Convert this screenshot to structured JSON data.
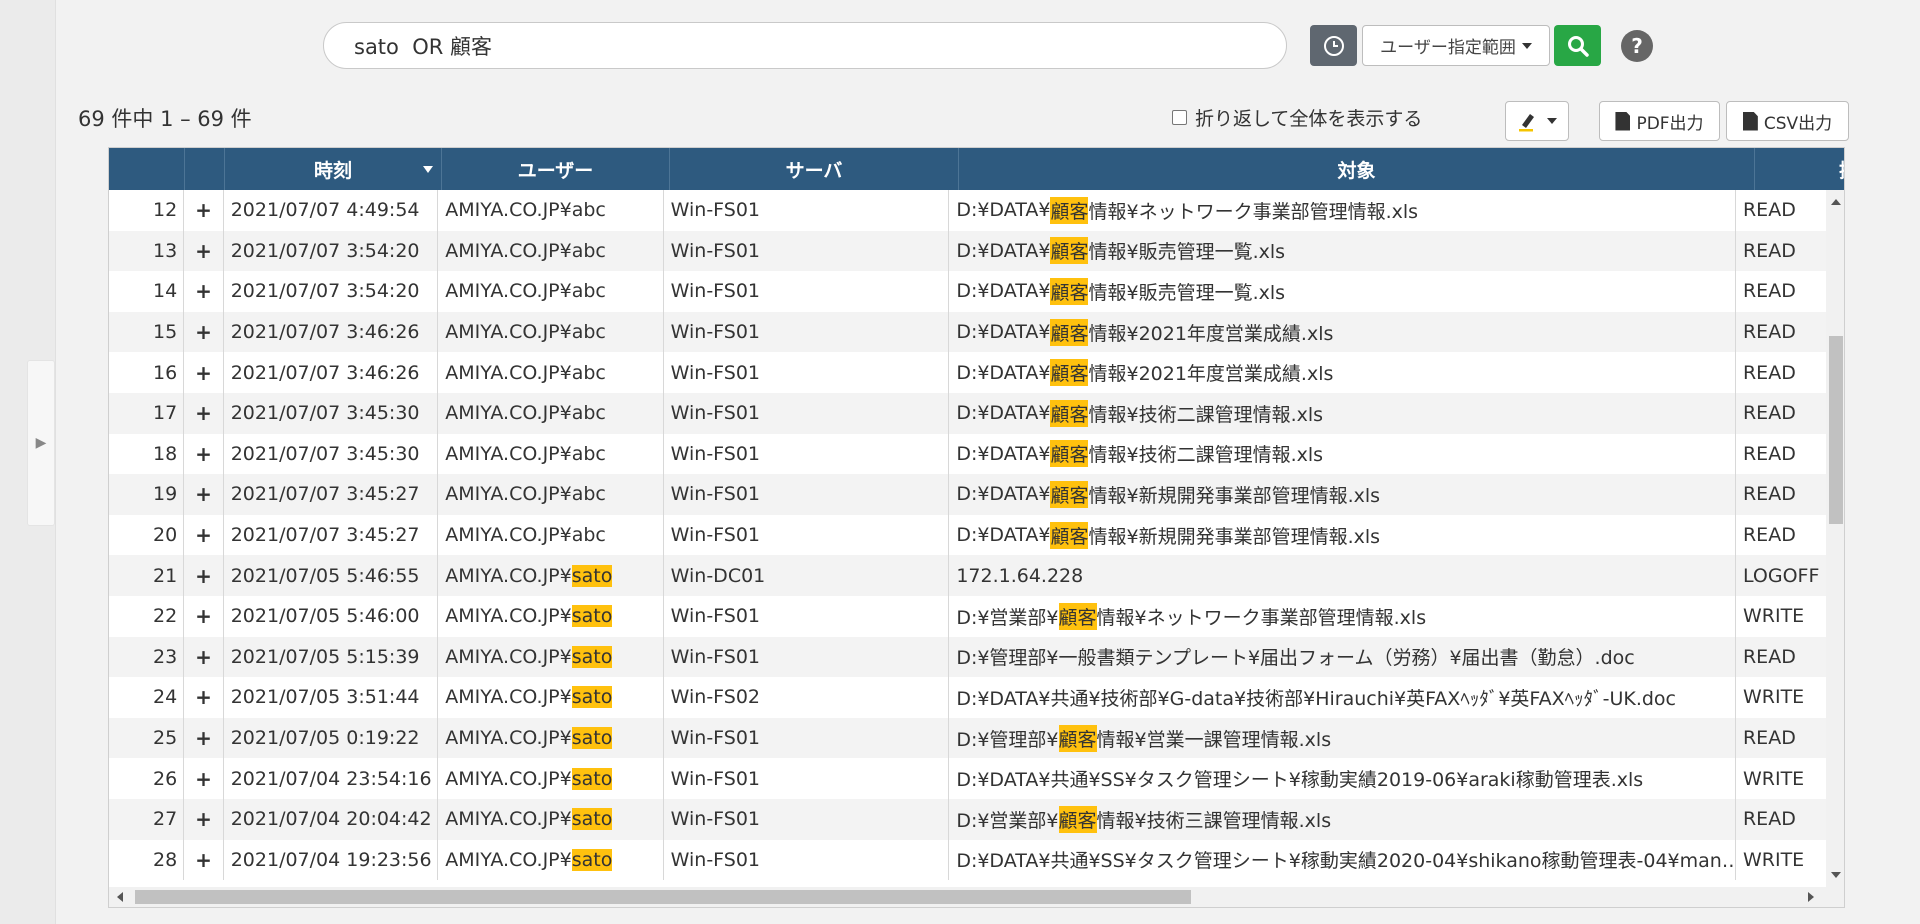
{
  "search": {
    "query": "sato  OR 顧客",
    "range_label": "ユーザー指定範囲"
  },
  "toolbar": {
    "result_count": "69 件中 1 – 69 件",
    "wrap_label": "折り返して全体を表示する",
    "pdf_label": "PDF出力",
    "csv_label": "CSV出力"
  },
  "colors": {
    "header_bg": "#2e5a7f",
    "highlight": "#ffc10e",
    "search_button": "#28a745",
    "history_button": "#5f6770"
  },
  "table": {
    "columns": [
      "",
      "",
      "時刻",
      "ユーザー",
      "サーバ",
      "対象",
      "操"
    ],
    "sorted_column": "時刻",
    "rows": [
      {
        "no": "12",
        "time": "2021/07/07 4:49:54",
        "user_pre": "AMIYA.CO.JP¥abc",
        "user_hl": "",
        "server": "Win-FS01",
        "t_pre": "D:¥DATA¥",
        "t_hl": "顧客",
        "t_post": "情報¥ネットワーク事業部管理情報.xls",
        "op": "READ"
      },
      {
        "no": "13",
        "time": "2021/07/07 3:54:20",
        "user_pre": "AMIYA.CO.JP¥abc",
        "user_hl": "",
        "server": "Win-FS01",
        "t_pre": "D:¥DATA¥",
        "t_hl": "顧客",
        "t_post": "情報¥販売管理一覧.xls",
        "op": "READ"
      },
      {
        "no": "14",
        "time": "2021/07/07 3:54:20",
        "user_pre": "AMIYA.CO.JP¥abc",
        "user_hl": "",
        "server": "Win-FS01",
        "t_pre": "D:¥DATA¥",
        "t_hl": "顧客",
        "t_post": "情報¥販売管理一覧.xls",
        "op": "READ"
      },
      {
        "no": "15",
        "time": "2021/07/07 3:46:26",
        "user_pre": "AMIYA.CO.JP¥abc",
        "user_hl": "",
        "server": "Win-FS01",
        "t_pre": "D:¥DATA¥",
        "t_hl": "顧客",
        "t_post": "情報¥2021年度営業成績.xls",
        "op": "READ"
      },
      {
        "no": "16",
        "time": "2021/07/07 3:46:26",
        "user_pre": "AMIYA.CO.JP¥abc",
        "user_hl": "",
        "server": "Win-FS01",
        "t_pre": "D:¥DATA¥",
        "t_hl": "顧客",
        "t_post": "情報¥2021年度営業成績.xls",
        "op": "READ"
      },
      {
        "no": "17",
        "time": "2021/07/07 3:45:30",
        "user_pre": "AMIYA.CO.JP¥abc",
        "user_hl": "",
        "server": "Win-FS01",
        "t_pre": "D:¥DATA¥",
        "t_hl": "顧客",
        "t_post": "情報¥技術二課管理情報.xls",
        "op": "READ"
      },
      {
        "no": "18",
        "time": "2021/07/07 3:45:30",
        "user_pre": "AMIYA.CO.JP¥abc",
        "user_hl": "",
        "server": "Win-FS01",
        "t_pre": "D:¥DATA¥",
        "t_hl": "顧客",
        "t_post": "情報¥技術二課管理情報.xls",
        "op": "READ"
      },
      {
        "no": "19",
        "time": "2021/07/07 3:45:27",
        "user_pre": "AMIYA.CO.JP¥abc",
        "user_hl": "",
        "server": "Win-FS01",
        "t_pre": "D:¥DATA¥",
        "t_hl": "顧客",
        "t_post": "情報¥新規開発事業部管理情報.xls",
        "op": "READ"
      },
      {
        "no": "20",
        "time": "2021/07/07 3:45:27",
        "user_pre": "AMIYA.CO.JP¥abc",
        "user_hl": "",
        "server": "Win-FS01",
        "t_pre": "D:¥DATA¥",
        "t_hl": "顧客",
        "t_post": "情報¥新規開発事業部管理情報.xls",
        "op": "READ"
      },
      {
        "no": "21",
        "time": "2021/07/05 5:46:55",
        "user_pre": "AMIYA.CO.JP¥",
        "user_hl": "sato",
        "server": "Win-DC01",
        "t_pre": "172.1.64.228",
        "t_hl": "",
        "t_post": "",
        "op": "LOGOFF"
      },
      {
        "no": "22",
        "time": "2021/07/05 5:46:00",
        "user_pre": "AMIYA.CO.JP¥",
        "user_hl": "sato",
        "server": "Win-FS01",
        "t_pre": "D:¥営業部¥",
        "t_hl": "顧客",
        "t_post": "情報¥ネットワーク事業部管理情報.xls",
        "op": "WRITE"
      },
      {
        "no": "23",
        "time": "2021/07/05 5:15:39",
        "user_pre": "AMIYA.CO.JP¥",
        "user_hl": "sato",
        "server": "Win-FS01",
        "t_pre": "D:¥管理部¥一般書類テンプレート¥届出フォーム（労務）¥届出書（勤怠）.doc",
        "t_hl": "",
        "t_post": "",
        "op": "READ"
      },
      {
        "no": "24",
        "time": "2021/07/05 3:51:44",
        "user_pre": "AMIYA.CO.JP¥",
        "user_hl": "sato",
        "server": "Win-FS02",
        "t_pre": "D:¥DATA¥共通¥技術部¥G-data¥技術部¥Hirauchi¥英FAXﾍｯﾀﾞ¥英FAXﾍｯﾀﾞ-UK.doc",
        "t_hl": "",
        "t_post": "",
        "op": "WRITE"
      },
      {
        "no": "25",
        "time": "2021/07/05 0:19:22",
        "user_pre": "AMIYA.CO.JP¥",
        "user_hl": "sato",
        "server": "Win-FS01",
        "t_pre": "D:¥管理部¥",
        "t_hl": "顧客",
        "t_post": "情報¥営業一課管理情報.xls",
        "op": "READ"
      },
      {
        "no": "26",
        "time": "2021/07/04 23:54:16",
        "user_pre": "AMIYA.CO.JP¥",
        "user_hl": "sato",
        "server": "Win-FS01",
        "t_pre": "D:¥DATA¥共通¥SS¥タスク管理シート¥稼動実績2019-06¥araki稼動管理表.xls",
        "t_hl": "",
        "t_post": "",
        "op": "WRITE"
      },
      {
        "no": "27",
        "time": "2021/07/04 20:04:42",
        "user_pre": "AMIYA.CO.JP¥",
        "user_hl": "sato",
        "server": "Win-FS01",
        "t_pre": "D:¥営業部¥",
        "t_hl": "顧客",
        "t_post": "情報¥技術三課管理情報.xls",
        "op": "READ"
      },
      {
        "no": "28",
        "time": "2021/07/04 19:23:56",
        "user_pre": "AMIYA.CO.JP¥",
        "user_hl": "sato",
        "server": "Win-FS01",
        "t_pre": "D:¥DATA¥共通¥SS¥タスク管理シート¥稼動実績2020-04¥shikano稼動管理表-04¥man…",
        "t_hl": "",
        "t_post": "",
        "op": "WRITE"
      }
    ]
  }
}
